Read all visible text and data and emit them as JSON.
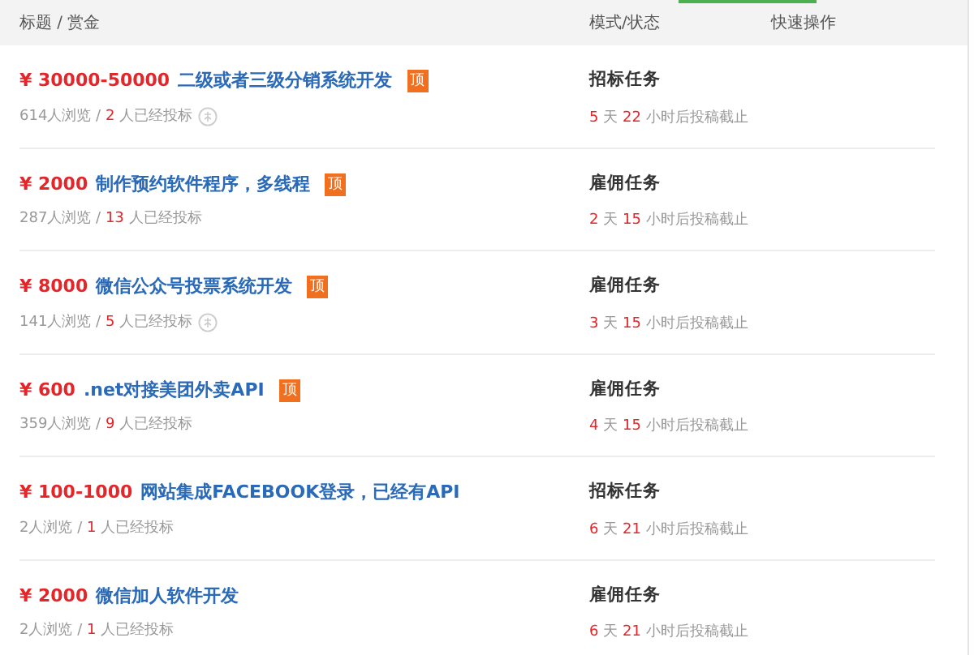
{
  "header": {
    "columns": [
      "标题 / 赏金",
      "模式/状态",
      "快速操作"
    ]
  },
  "tasks": [
    {
      "price": "¥ 30000-50000",
      "title": "二级或者三级分销系统开发",
      "badge": "顶",
      "verified": true,
      "meta": [
        {
          "text": "614人浏览 / ",
          "highlight": false
        },
        {
          "text": "2",
          "highlight": true
        },
        {
          "text": " 人已经投标",
          "highlight": false
        }
      ],
      "mode": "招标任务",
      "deadline": [
        {
          "text": "5",
          "highlight": true
        },
        {
          "text": " 天 ",
          "highlight": false
        },
        {
          "text": "22",
          "highlight": true
        },
        {
          "text": " 小时后投稿截止",
          "highlight": false
        }
      ]
    },
    {
      "price": "¥ 2000",
      "title": "制作预约软件程序，多线程",
      "badge": "顶",
      "verified": false,
      "meta": [
        {
          "text": "287人浏览 / ",
          "highlight": false
        },
        {
          "text": "13",
          "highlight": true
        },
        {
          "text": " 人已经投标",
          "highlight": false
        }
      ],
      "mode": "雇佣任务",
      "deadline": [
        {
          "text": "2",
          "highlight": true
        },
        {
          "text": " 天 ",
          "highlight": false
        },
        {
          "text": "15",
          "highlight": true
        },
        {
          "text": " 小时后投稿截止",
          "highlight": false
        }
      ]
    },
    {
      "price": "¥ 8000",
      "title": "微信公众号投票系统开发",
      "badge": "顶",
      "verified": true,
      "meta": [
        {
          "text": "141人浏览 / ",
          "highlight": false
        },
        {
          "text": "5",
          "highlight": true
        },
        {
          "text": " 人已经投标",
          "highlight": false
        }
      ],
      "mode": "雇佣任务",
      "deadline": [
        {
          "text": "3",
          "highlight": true
        },
        {
          "text": " 天 ",
          "highlight": false
        },
        {
          "text": "15",
          "highlight": true
        },
        {
          "text": " 小时后投稿截止",
          "highlight": false
        }
      ]
    },
    {
      "price": "¥ 600",
      "title": ".net对接美团外卖API",
      "badge": "顶",
      "verified": false,
      "meta": [
        {
          "text": "359人浏览 / ",
          "highlight": false
        },
        {
          "text": "9",
          "highlight": true
        },
        {
          "text": " 人已经投标",
          "highlight": false
        }
      ],
      "mode": "雇佣任务",
      "deadline": [
        {
          "text": "4",
          "highlight": true
        },
        {
          "text": " 天 ",
          "highlight": false
        },
        {
          "text": "15",
          "highlight": true
        },
        {
          "text": " 小时后投稿截止",
          "highlight": false
        }
      ]
    },
    {
      "price": "¥ 100-1000",
      "title": "网站集成FACEBOOK登录，已经有API",
      "verified": false,
      "meta": [
        {
          "text": "2人浏览 / ",
          "highlight": false
        },
        {
          "text": "1",
          "highlight": true
        },
        {
          "text": " 人已经投标",
          "highlight": false
        }
      ],
      "mode": "招标任务",
      "deadline": [
        {
          "text": "6",
          "highlight": true
        },
        {
          "text": " 天 ",
          "highlight": false
        },
        {
          "text": "21",
          "highlight": true
        },
        {
          "text": " 小时后投稿截止",
          "highlight": false
        }
      ]
    },
    {
      "price": "¥ 2000",
      "title": "微信加人软件开发",
      "verified": false,
      "meta": [
        {
          "text": "2人浏览 / ",
          "highlight": false
        },
        {
          "text": "1",
          "highlight": true
        },
        {
          "text": " 人已经投标",
          "highlight": false
        }
      ],
      "mode": "雇佣任务",
      "deadline": [
        {
          "text": "6",
          "highlight": true
        },
        {
          "text": " 天 ",
          "highlight": false
        },
        {
          "text": "21",
          "highlight": true
        },
        {
          "text": " 小时后投稿截止",
          "highlight": false
        }
      ]
    }
  ]
}
